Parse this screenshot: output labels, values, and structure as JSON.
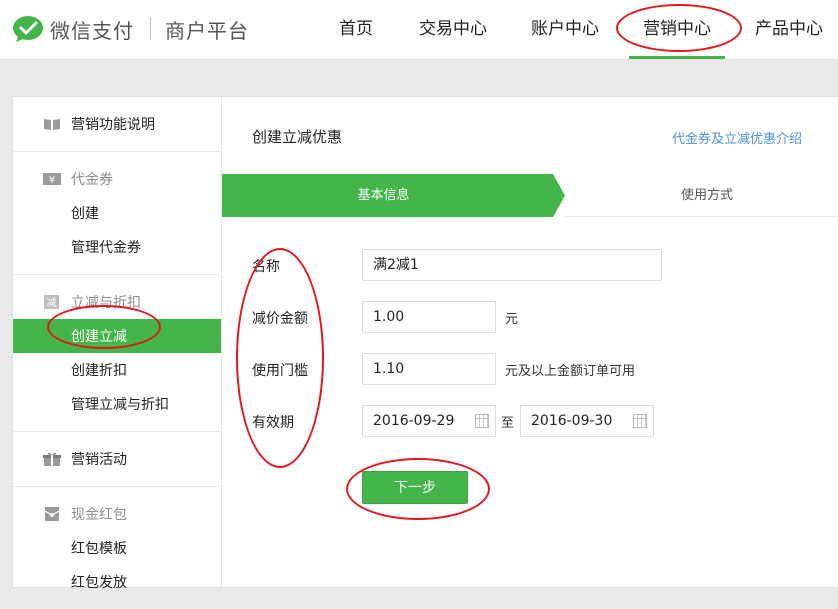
{
  "brand": {
    "name": "微信支付",
    "subtitle": "商户平台",
    "accent": "#44b549"
  },
  "nav": {
    "items": [
      {
        "label": "首页",
        "active": false
      },
      {
        "label": "交易中心",
        "active": false
      },
      {
        "label": "账户中心",
        "active": false
      },
      {
        "label": "营销中心",
        "active": true
      },
      {
        "label": "产品中心",
        "active": false
      }
    ]
  },
  "sidebar": {
    "groups": [
      {
        "head": {
          "label": "营销功能说明",
          "icon": "book-icon"
        },
        "items": []
      },
      {
        "head": {
          "label": "代金券",
          "icon": "yen-icon"
        },
        "items": [
          {
            "label": "创建"
          },
          {
            "label": "管理代金券"
          }
        ]
      },
      {
        "head": {
          "label": "立减与折扣",
          "icon": "discount-icon"
        },
        "items": [
          {
            "label": "创建立减",
            "active": true
          },
          {
            "label": "创建折扣"
          },
          {
            "label": "管理立减与折扣"
          }
        ]
      },
      {
        "head": {
          "label": "营销活动",
          "icon": "gift-icon"
        },
        "items": []
      },
      {
        "head": {
          "label": "现金红包",
          "icon": "red-packet-icon"
        },
        "items": [
          {
            "label": "红包模板"
          },
          {
            "label": "红包发放"
          }
        ]
      }
    ]
  },
  "content": {
    "title": "创建立减优惠",
    "help_link": "代金券及立减优惠介绍",
    "steps": {
      "current": "基本信息",
      "next": "使用方式"
    },
    "form": {
      "name_label": "名称",
      "name_value": "满2减1",
      "discount_label": "减价金额",
      "discount_value": "1.00",
      "discount_unit": "元",
      "threshold_label": "使用门槛",
      "threshold_value": "1.10",
      "threshold_suffix": "元及以上金额订单可用",
      "validity_label": "有效期",
      "date_from": "2016-09-29",
      "date_sep": "至",
      "date_to": "2016-09-30"
    },
    "next_button": "下一步"
  }
}
